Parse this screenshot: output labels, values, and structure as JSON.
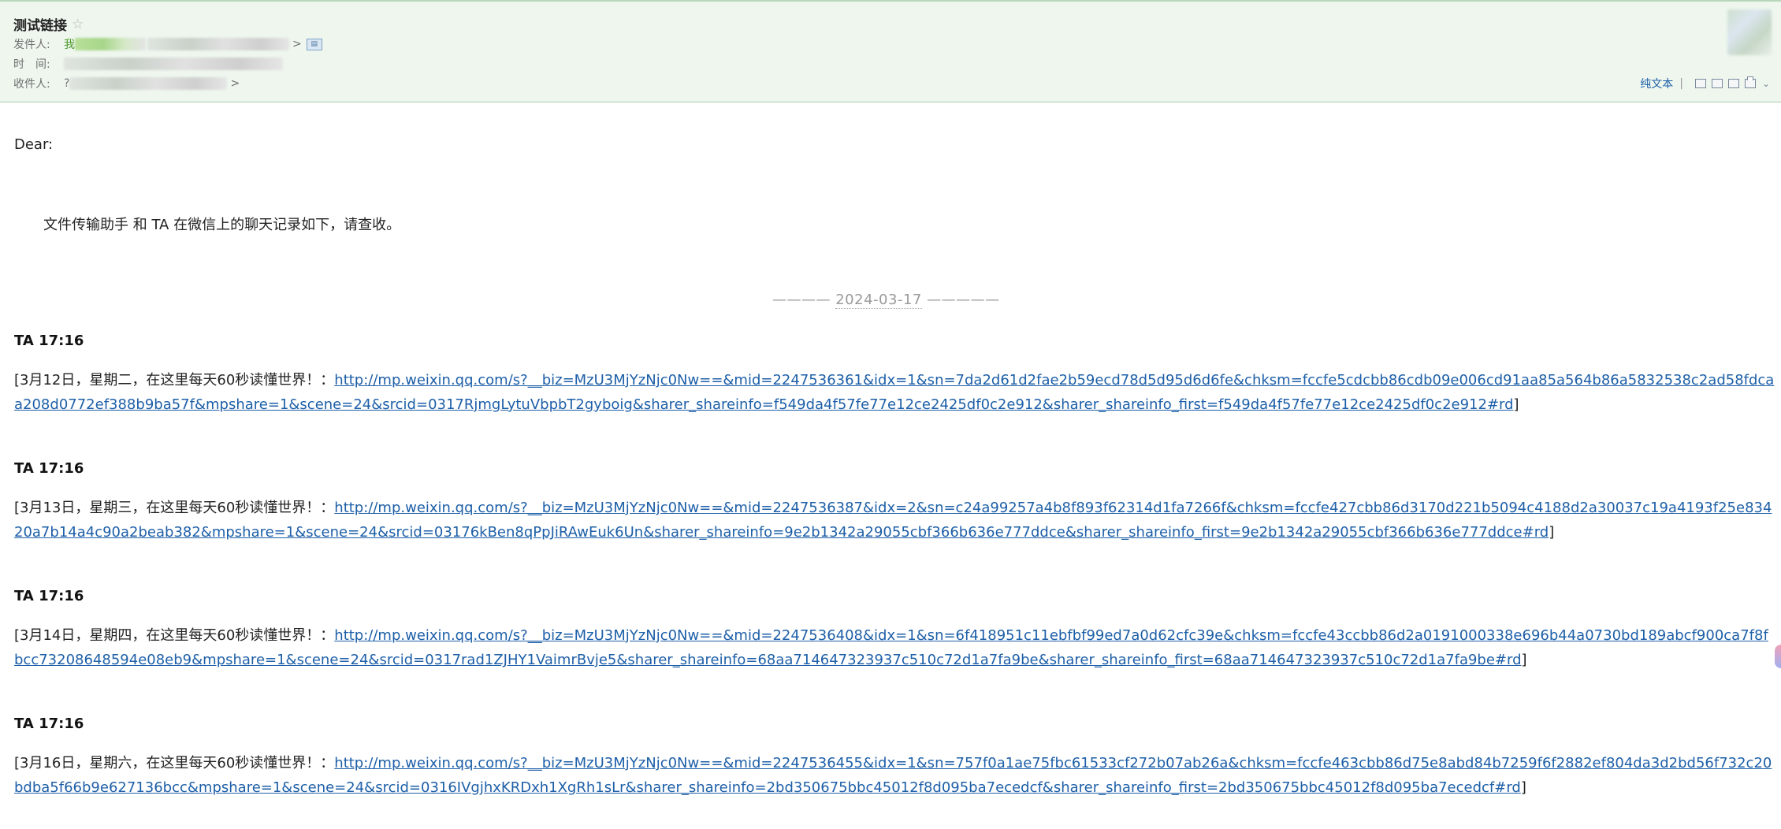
{
  "header": {
    "subject": "测试链接",
    "star_icon": "star-icon",
    "sender_label": "发件人:",
    "sender_prefix": "我",
    "sender_suffix": ">",
    "time_label": "时　间:",
    "recipient_label": "收件人:",
    "recipient_prefix": "?",
    "recipient_suffix": ">",
    "plain_text_label": "纯文本",
    "separator": "|"
  },
  "body": {
    "greeting": "Dear:",
    "intro": "文件传输助手 和 TA 在微信上的聊天记录如下，请查收。",
    "date_prefix": "———— ",
    "date": "2024-03-17",
    "date_suffix": " —————",
    "messages": [
      {
        "header": "TA 17:16",
        "text": "[3月12日，星期二，在这里每天60秒读懂世界！：",
        "link": "http://mp.weixin.qq.com/s?__biz=MzU3MjYzNjc0Nw==&mid=2247536361&idx=1&sn=7da2d61d2fae2b59ecd78d5d95d6d6fe&chksm=fccfe5cdcbb86cdb09e006cd91aa85a564b86a5832538c2ad58fdcaa208d0772ef388b9ba57f&mpshare=1&scene=24&srcid=0317RjmgLytuVbpbT2gyboig&sharer_shareinfo=f549da4f57fe77e12ce2425df0c2e912&sharer_shareinfo_first=f549da4f57fe77e12ce2425df0c2e912#rd",
        "close": "]"
      },
      {
        "header": "TA 17:16",
        "text": "[3月13日，星期三，在这里每天60秒读懂世界！：",
        "link": "http://mp.weixin.qq.com/s?__biz=MzU3MjYzNjc0Nw==&mid=2247536387&idx=2&sn=c24a99257a4b8f893f62314d1fa7266f&chksm=fccfe427cbb86d3170d221b5094c4188d2a30037c19a4193f25e83420a7b14a4c90a2beab382&mpshare=1&scene=24&srcid=03176kBen8qPpJiRAwEuk6Un&sharer_shareinfo=9e2b1342a29055cbf366b636e777ddce&sharer_shareinfo_first=9e2b1342a29055cbf366b636e777ddce#rd",
        "close": "]"
      },
      {
        "header": "TA 17:16",
        "text": "[3月14日，星期四，在这里每天60秒读懂世界！：",
        "link": "http://mp.weixin.qq.com/s?__biz=MzU3MjYzNjc0Nw==&mid=2247536408&idx=1&sn=6f418951c11ebfbf99ed7a0d62cfc39e&chksm=fccfe43ccbb86d2a0191000338e696b44a0730bd189abcf900ca7f8fbcc73208648594e08eb9&mpshare=1&scene=24&srcid=0317rad1ZJHY1VaimrBvje5&sharer_shareinfo=68aa714647323937c510c72d1a7fa9be&sharer_shareinfo_first=68aa714647323937c510c72d1a7fa9be#rd",
        "close": "]"
      },
      {
        "header": "TA 17:16",
        "text": "[3月16日，星期六，在这里每天60秒读懂世界！：",
        "link": "http://mp.weixin.qq.com/s?__biz=MzU3MjYzNjc0Nw==&mid=2247536455&idx=1&sn=757f0a1ae75fbc61533cf272b07ab26a&chksm=fccfe463cbb86d75e8abd84b7259f6f2882ef804da3d2bd56f732c20bdba5f66b9e627136bcc&mpshare=1&scene=24&srcid=0316IVgjhxKRDxh1XgRh1sLr&sharer_shareinfo=2bd350675bbc45012f8d095ba7ecedcf&sharer_shareinfo_first=2bd350675bbc45012f8d095ba7ecedcf#rd",
        "close": "]"
      }
    ]
  },
  "colors": {
    "header_bg": "#eef6ee",
    "link": "#1d5fa8",
    "muted": "#707070"
  }
}
